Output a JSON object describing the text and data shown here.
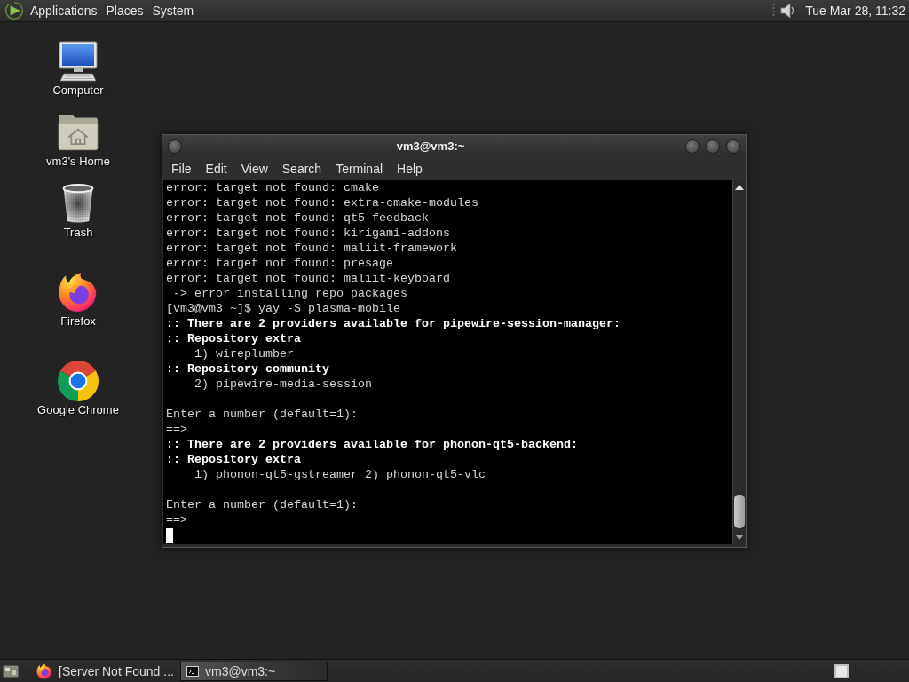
{
  "top_panel": {
    "menus": [
      "Applications",
      "Places",
      "System"
    ],
    "clock": "Tue Mar 28, 11:32"
  },
  "desktop_icons": [
    {
      "kind": "computer",
      "label": "Computer"
    },
    {
      "kind": "home",
      "label": "vm3's Home"
    },
    {
      "kind": "trash",
      "label": "Trash"
    },
    {
      "kind": "firefox",
      "label": "Firefox"
    },
    {
      "kind": "chrome",
      "label": "Google Chrome"
    }
  ],
  "terminal": {
    "title": "vm3@vm3:~",
    "menu": [
      "File",
      "Edit",
      "View",
      "Search",
      "Terminal",
      "Help"
    ],
    "lines": [
      {
        "kind": "plain",
        "text": "error: target not found: cmake"
      },
      {
        "kind": "plain",
        "text": "error: target not found: extra-cmake-modules"
      },
      {
        "kind": "plain",
        "text": "error: target not found: qt5-feedback"
      },
      {
        "kind": "plain",
        "text": "error: target not found: kirigami-addons"
      },
      {
        "kind": "plain",
        "text": "error: target not found: maliit-framework"
      },
      {
        "kind": "plain",
        "text": "error: target not found: presage"
      },
      {
        "kind": "plain",
        "text": "error: target not found: maliit-keyboard"
      },
      {
        "kind": "plain",
        "text": " -> error installing repo packages"
      },
      {
        "kind": "plain",
        "text": "[vm3@vm3 ~]$ yay -S plasma-mobile"
      },
      {
        "kind": "bold",
        "text": ":: There are 2 providers available for pipewire-session-manager:"
      },
      {
        "kind": "bold",
        "text": ":: Repository extra"
      },
      {
        "kind": "plain",
        "text": "    1) wireplumber"
      },
      {
        "kind": "bold",
        "text": ":: Repository community"
      },
      {
        "kind": "plain",
        "text": "    2) pipewire-media-session"
      },
      {
        "kind": "blank"
      },
      {
        "kind": "plain",
        "text": "Enter a number (default=1):"
      },
      {
        "kind": "plain",
        "text": "==>"
      },
      {
        "kind": "bold",
        "text": ":: There are 2 providers available for phonon-qt5-backend:"
      },
      {
        "kind": "bold",
        "text": ":: Repository extra"
      },
      {
        "kind": "plain",
        "text": "    1) phonon-qt5-gstreamer 2) phonon-qt5-vlc"
      },
      {
        "kind": "blank"
      },
      {
        "kind": "plain",
        "text": "Enter a number (default=1):"
      },
      {
        "kind": "plain",
        "text": "==>"
      },
      {
        "kind": "cursor"
      }
    ]
  },
  "taskbar": {
    "tasks": [
      {
        "kind": "browser",
        "label": "[Server Not Found ...",
        "selected": false
      },
      {
        "kind": "terminal",
        "label": "vm3@vm3:~",
        "selected": true
      }
    ]
  }
}
